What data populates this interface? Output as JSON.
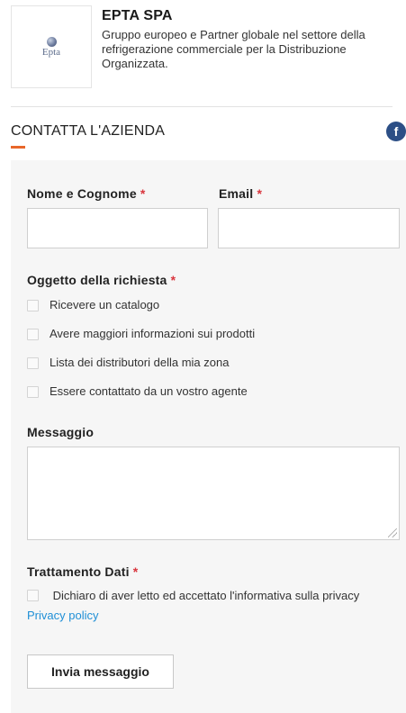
{
  "company": {
    "logo_text": "Epta",
    "name": "EPTA SPA",
    "description": "Gruppo europeo e Partner globale nel settore della refrigerazione commerciale per la Distribuzione Organizzata."
  },
  "section": {
    "title": "CONTATTA L'AZIENDA",
    "social_icon": "facebook-icon",
    "social_glyph": "f"
  },
  "form": {
    "name_label": "Nome e Cognome",
    "email_label": "Email",
    "required_mark": "*",
    "subject_label": "Oggetto della richiesta",
    "subject_options": [
      "Ricevere un catalogo",
      "Avere maggiori informazioni sui prodotti",
      "Lista dei distributori della mia zona",
      "Essere contattato da un vostro agente"
    ],
    "message_label": "Messaggio",
    "privacy_label": "Trattamento Dati",
    "privacy_text": "Dichiaro di aver letto ed accettato l'informativa sulla privacy",
    "privacy_link": "Privacy policy",
    "submit_label": "Invia messaggio"
  },
  "colors": {
    "accent": "#e8672a",
    "required": "#d9363e",
    "link": "#1f8fd6",
    "facebook": "#2c4f86",
    "panel_bg": "#f6f6f6"
  }
}
